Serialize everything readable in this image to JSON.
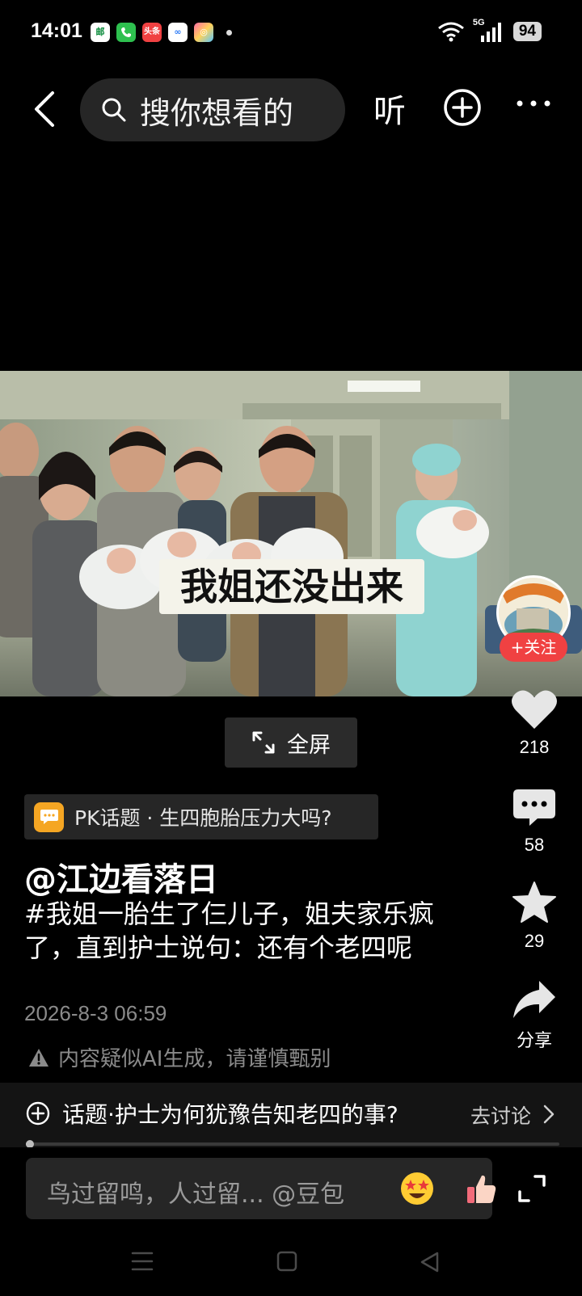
{
  "status_bar": {
    "time": "14:01",
    "apps": [
      "邮",
      "📞",
      "头条",
      "∞",
      "◎"
    ],
    "network": "5G",
    "battery": "94"
  },
  "top_bar": {
    "search_placeholder": "搜你想看的",
    "listen_label": "听"
  },
  "video": {
    "caption": "我姐还没出来",
    "progress_fraction": 0.005
  },
  "author_avatar": {
    "follow_label": "+关注"
  },
  "fullscreen_label": "全屏",
  "actions": {
    "like_count": "218",
    "comment_count": "58",
    "favorite_count": "29",
    "share_label": "分享"
  },
  "pk_topic": "PK话题 · 生四胞胎压力大吗?",
  "author_name": "@江边看落日",
  "description": "#我姐一胎生了仨儿子，姐夫家乐疯了，直到护士说句：还有个老四呢",
  "timestamp": "2026-8-3 06:59",
  "ai_warning": "内容疑似AI生成，请谨慎甄别",
  "topic_bar": {
    "text": "话题·护士为何犹豫告知老四的事?",
    "link": "去讨论"
  },
  "comment_bar": {
    "placeholder": "鸟过留鸣，人过留... @豆包"
  },
  "colors": {
    "background": "#000000",
    "follow_red": "#f04142",
    "pk_orange": "#f5a623",
    "muted_text": "#8a8a8a"
  }
}
